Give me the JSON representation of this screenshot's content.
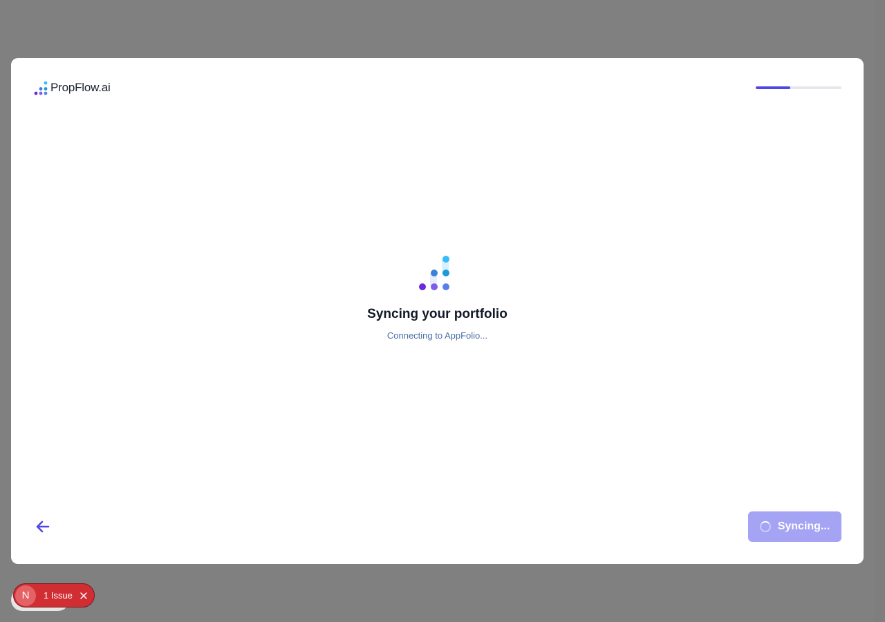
{
  "header": {
    "logo_text": "PropFlow.ai",
    "progress_fraction": 0.4
  },
  "main": {
    "title": "Syncing your portfolio",
    "subtitle": "Connecting to AppFolio..."
  },
  "footer": {
    "back_icon": "arrow-left-icon",
    "sync_label": "Syncing..."
  },
  "issues_badge": {
    "letter": "N",
    "label": "1 Issue",
    "close_icon": "close-icon"
  },
  "colors": {
    "accent": "#4f46e5",
    "button_disabled": "#a5a3f3",
    "issue_red": "#d02e33"
  }
}
